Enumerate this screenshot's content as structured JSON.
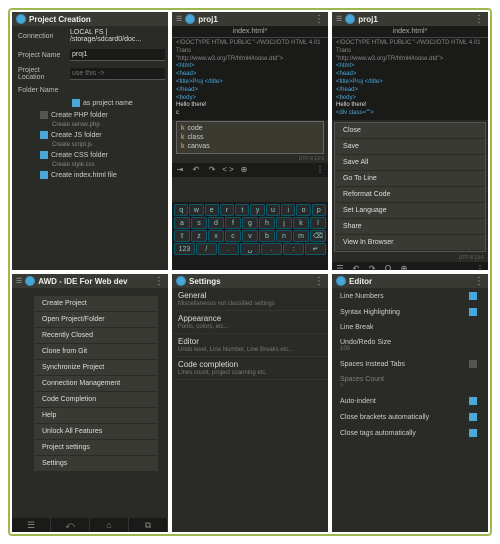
{
  "pane1": {
    "title": "Project Creation",
    "connection_label": "Connection",
    "connection_value": "LOCAL FS | /storage/sdcard0/doc...",
    "project_name_label": "Project Name",
    "project_name_value": "proj1",
    "project_location_label": "Project Location",
    "project_location_placeholder": "use this ->",
    "folder_name_label": "Folder Name",
    "as_project_name": "as project name",
    "chk_php": "Create PHP folder",
    "sub_php": "Create server.php",
    "chk_js": "Create JS folder",
    "sub_js": "Create script.js",
    "chk_css": "Create CSS folder",
    "sub_css": "Create style.css",
    "chk_html": "Create index.html file"
  },
  "pane2": {
    "title": "proj1",
    "tab": "index.html*",
    "doctype": "<!DOCTYPE HTML PUBLIC \"-//W3C//DTD HTML 4.01 Trans",
    "url": "\"http://www.w3.org/TR/html4/loose.dtd\">",
    "l_html": "<html>",
    "l_head": "<head>",
    "l_title": " <title>Proj   </title>",
    "l_headc": "</head>",
    "l_body": "<body>",
    "l_hello": " Hello there!",
    "l_c": " c",
    "ac1_k": "k",
    "ac1": "code",
    "ac2_k": "k",
    "ac2": "class",
    "ac3_k": "k",
    "ac3": "canvas",
    "stat": "UTF-8  13:6"
  },
  "pane3": {
    "title": "proj1",
    "tab": "index.html*",
    "doctype": "<!DOCTYPE HTML PUBLIC \"-//W3C//DTD HTML 4.01 Trans",
    "url": "\"http://www.w3.org/TR/html4/loose.dtd\">",
    "l_html": "<html>",
    "l_head": "<head>",
    "l_title": " <title>Proj   </title>",
    "l_headc": "</head>",
    "l_body": "<body>",
    "l_hello": " Hello there!",
    "l_div": " <div class=\"\">",
    "ctx": [
      "Close",
      "Save",
      "Save All",
      "Go To Line",
      "Reformat Code",
      "Set Language",
      "Share",
      "View In Browser"
    ],
    "stat": "UTF-8  13:6"
  },
  "pane4": {
    "title": "AWD - IDE For Web dev",
    "menu": [
      "Create Project",
      "Open Project/Folder",
      "Recently Closed",
      "Clone from Git",
      "Synchronize Project",
      "Connection Management",
      "Code Completion",
      "Help",
      "Unlock All Features",
      "Project settings",
      "Settings"
    ]
  },
  "pane5": {
    "title": "Settings",
    "items": [
      {
        "t": "General",
        "s": "Miscellaneous not classified settings"
      },
      {
        "t": "Appearance",
        "s": "Fonts, colors, etc..."
      },
      {
        "t": "Editor",
        "s": "Undo level, Line Number, Line Breaks etc..."
      },
      {
        "t": "Code completion",
        "s": "Lines count, project scanning etc."
      }
    ]
  },
  "pane6": {
    "title": "Editor",
    "line_numbers": "Line Numbers",
    "syntax": "Syntax Highlighting",
    "line_break": "Line Break",
    "undo_label": "Undo/Redo Size",
    "undo_val": "100",
    "spaces_tabs": "Spaces Instead Tabs",
    "spaces_count_label": "Spaces Count",
    "spaces_count_val": "4",
    "auto_indent": "Auto-indent",
    "close_brackets": "Close brackets automatically",
    "close_tags": "Close tags automatically"
  },
  "kbd": {
    "r1": [
      "⇥",
      "↶",
      "↷",
      "< >",
      "⊕",
      "⋮"
    ],
    "r2": [
      "q",
      "w",
      "e",
      "r",
      "t",
      "y",
      "u",
      "i",
      "o",
      "p"
    ],
    "r3": [
      "a",
      "s",
      "d",
      "f",
      "g",
      "h",
      "j",
      "k",
      "l"
    ],
    "r4": [
      "⇧",
      "z",
      "x",
      "c",
      "v",
      "b",
      "n",
      "m",
      "⌫"
    ],
    "r5": [
      "123",
      "/",
      ".",
      "␣",
      ".",
      ":",
      "↵"
    ]
  },
  "tool_icons": [
    "☰",
    "↶",
    "↷",
    "Q",
    "⊕",
    "⋮"
  ]
}
